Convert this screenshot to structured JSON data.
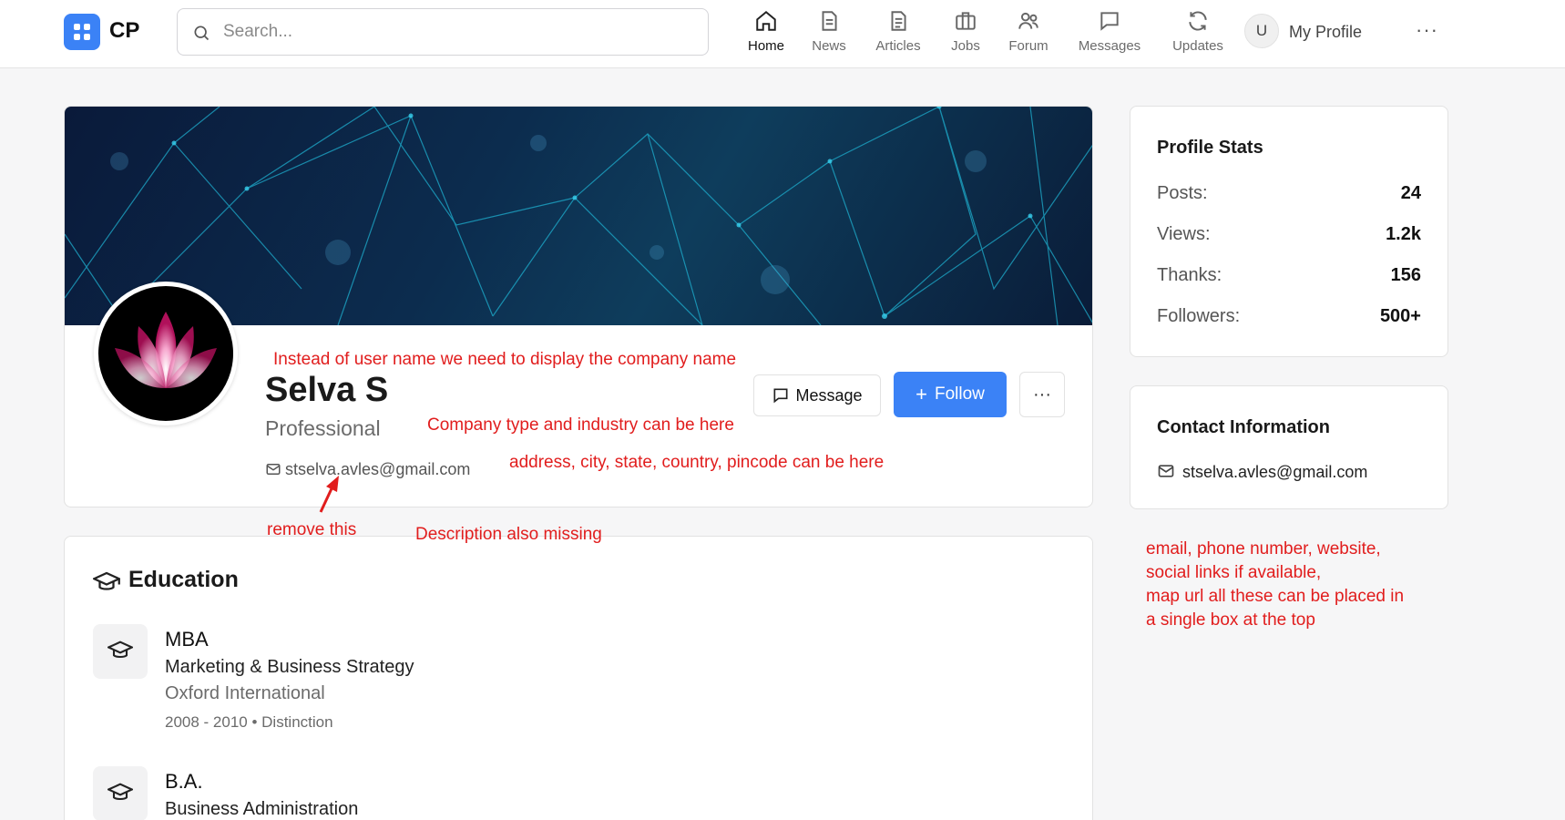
{
  "app": {
    "brand": "CP"
  },
  "search": {
    "placeholder": "Search..."
  },
  "nav": {
    "items": [
      {
        "label": "Home",
        "icon": "home-icon"
      },
      {
        "label": "News",
        "icon": "news-icon"
      },
      {
        "label": "Articles",
        "icon": "articles-icon"
      },
      {
        "label": "Jobs",
        "icon": "jobs-icon"
      },
      {
        "label": "Forum",
        "icon": "forum-icon"
      },
      {
        "label": "Messages",
        "icon": "messages-icon"
      },
      {
        "label": "Updates",
        "icon": "updates-icon"
      }
    ],
    "avatar_initial": "U",
    "profile_label": "My Profile",
    "more": "···"
  },
  "profile": {
    "name": "Selva S",
    "role": "Professional",
    "email": "stselva.avles@gmail.com",
    "message_label": "Message",
    "follow_label": "Follow",
    "follow_icon": "+",
    "more_label": "···"
  },
  "education": {
    "title": "Education",
    "items": [
      {
        "degree": "MBA",
        "field": "Marketing & Business Strategy",
        "school": "Oxford International",
        "meta": "2008 - 2010 • Distinction"
      },
      {
        "degree": "B.A.",
        "field": "Business Administration"
      }
    ]
  },
  "stats": {
    "title": "Profile Stats",
    "rows": [
      {
        "label": "Posts:",
        "value": "24"
      },
      {
        "label": "Views:",
        "value": "1.2k"
      },
      {
        "label": "Thanks:",
        "value": "156"
      },
      {
        "label": "Followers:",
        "value": "500+"
      }
    ]
  },
  "contact": {
    "title": "Contact Information",
    "email": "stselva.avles@gmail.com"
  },
  "annotations": {
    "company_name": "Instead of user name we need to display the company name",
    "company_type": "Company type and industry can be here",
    "address": "address, city, state, country, pincode can be here",
    "remove": "remove this",
    "description": "Description also missing",
    "contact_box": [
      "email, phone number, website,",
      "social links if available,",
      "map url all these can be placed in",
      "a single box at the top"
    ],
    "color": "#e11d1d"
  },
  "colors": {
    "accent": "#3b82f6",
    "annotation": "#e11d1d"
  }
}
